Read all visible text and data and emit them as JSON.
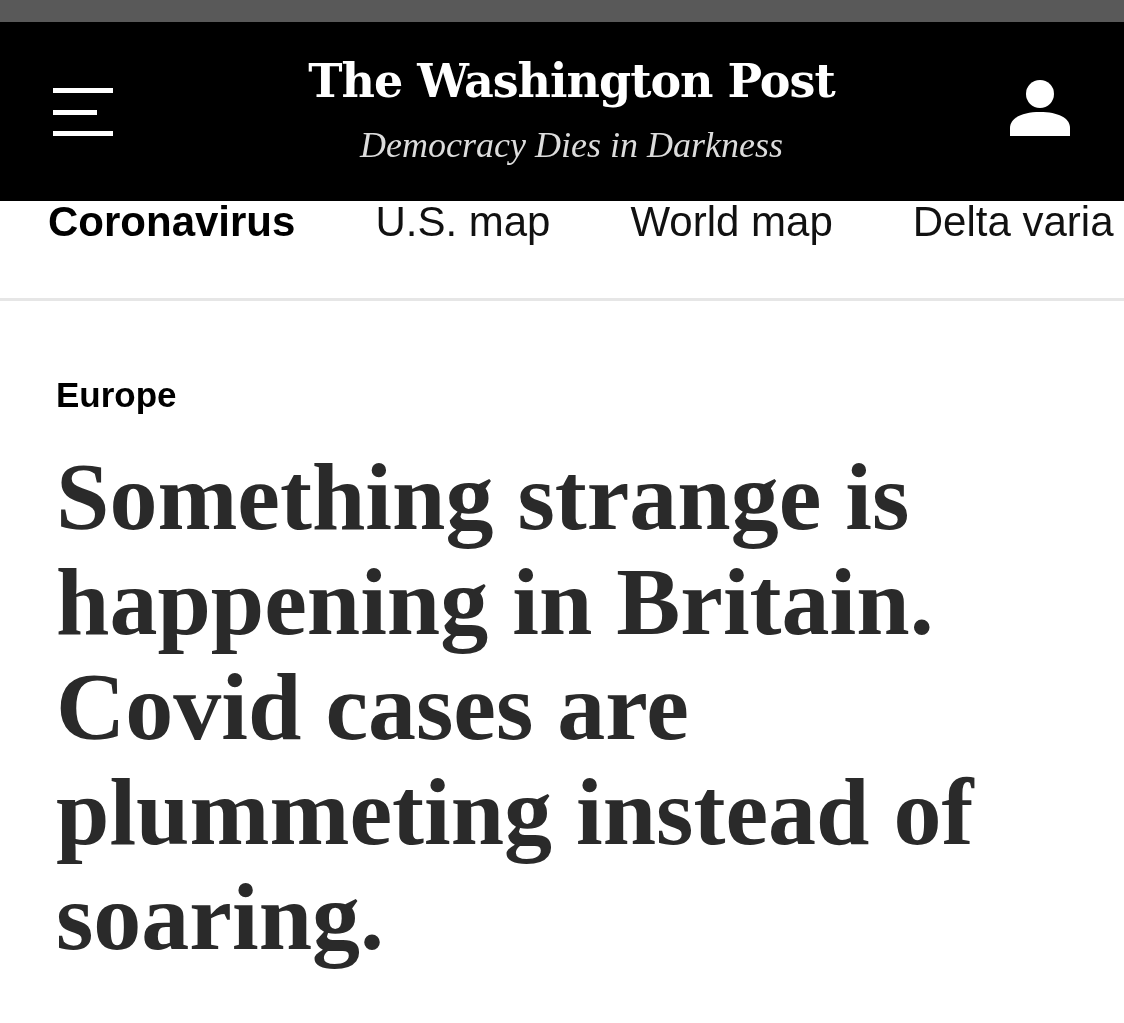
{
  "masthead": {
    "logo": "The Washington Post",
    "tagline": "Democracy Dies in Darkness"
  },
  "nav": [
    {
      "label": "Coronavirus",
      "selected": true
    },
    {
      "label": "U.S. map",
      "selected": false
    },
    {
      "label": "World map",
      "selected": false
    },
    {
      "label": "Delta varia",
      "selected": false
    }
  ],
  "article": {
    "section": "Europe",
    "headline": "Something strange is happening in Britain. Covid cases are plummeting instead of soaring."
  }
}
